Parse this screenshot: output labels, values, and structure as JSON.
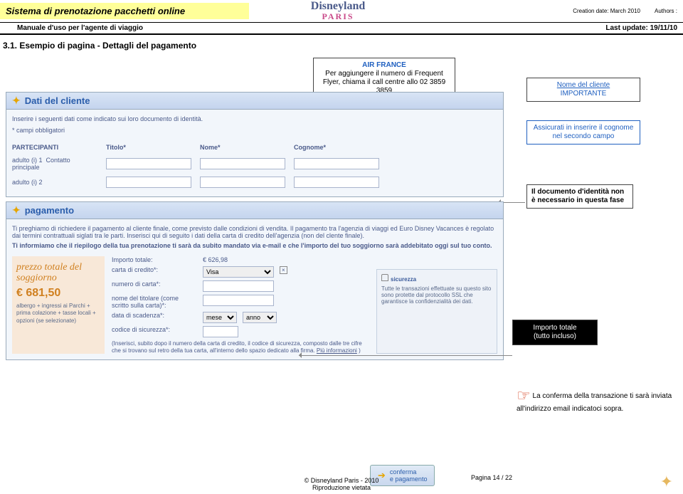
{
  "header": {
    "title": "Sistema di prenotazione pacchetti online",
    "subtitle": "Manuale d'uso per l'agente di viaggio",
    "logo_main": "Disneyland",
    "logo_sub": "PARIS",
    "creation_label": "Creation date:",
    "creation_value": "March 2010",
    "authors_label": "Authors :",
    "update_label": "Last update:",
    "update_value": "19/11/10"
  },
  "section": {
    "title": "3.1. Esempio di pagina - Dettagli del pagamento"
  },
  "panel_client": {
    "title": "Dati del cliente",
    "intro": "Inserire i seguenti dati come indicato sui loro documento di identità.",
    "required_note": "* campi obbligatori",
    "col_part": "PARTECIPANTI",
    "col_title": "Titolo*",
    "col_name": "Nome*",
    "col_surname": "Cognome*",
    "row1": "adulto (i)  1",
    "row1_sub": "Contatto principale",
    "row2": "adulto (i)  2"
  },
  "panel_pay": {
    "title": "pagamento",
    "intro": "Ti preghiamo di richiedere il pagamento al cliente finale, come previsto dalle condizioni di vendita. Il pagamento tra l'agenzia di viaggi ed Euro Disney Vacances è regolato dai termini contrattuali siglati tra le parti. Inserisci qui di seguito i dati della carta di credito dell'agenzia (non del clente finale).",
    "intro_bold": "Ti informiamo che il riepilogo della tua prenotazione ti sarà da subito mandato via e-mail e che l'importo del tuo soggiorno sarà addebitato oggi sul tuo conto.",
    "left_big": "prezzo totale del soggiorno",
    "left_price": "€ 681,50",
    "left_det": "albergo + ingressi ai Parchi + prima colazione + tasse locali + opzioni (se selezionate)",
    "f_importo": "Importo totale:",
    "f_importo_val": "€ 626,98",
    "f_card": "carta di credito*:",
    "f_card_val": "Visa",
    "f_num": "numero di carta*:",
    "f_holder": "nome del titolare (come scritto sulla carta)*:",
    "f_exp": "data di scadenza*:",
    "f_exp_m": "mese",
    "f_exp_y": "anno",
    "f_cvv": "codice di sicurezza*:",
    "f_help": "(Inserisci, subito dopo il numero della carta di credito, il codice di sicurezza, composto dalle tre cifre che si trovano sul retro della tua carta, all'interno dello spazio dedicato alla firma.",
    "f_help_link": "Più informazioni",
    "sec_title": "sicurezza",
    "sec_body": "Tutte le transazioni effettuate su questo sito sono protette dal protocollo SSL che garantisce la confidenzialità dei dati.",
    "btn_conf": "conferma",
    "btn_conf2": "e pagamento"
  },
  "callouts": {
    "air_title": "AIR FRANCE",
    "air_body": "Per aggiungere il numero di Frequent Flyer, chiama il call centre allo 02 3859 3859",
    "name_title": "Nome del cliente",
    "name_sub": "IMPORTANTE",
    "cogn": "Assicurati in inserire il cognome nel secondo campo",
    "doc": "Il documento d'identità non è necessario in questa fase",
    "imp1": "Importo totale",
    "imp2": "(tutto incluso)",
    "conf": "La conferma della transazione ti sarà inviata all'indirizzo email indicatoci sopra."
  },
  "footer": {
    "copy": "© Disneyland Paris - 2010",
    "rip": "Riproduzione vietata",
    "page": "Pagina 14 / 22"
  }
}
